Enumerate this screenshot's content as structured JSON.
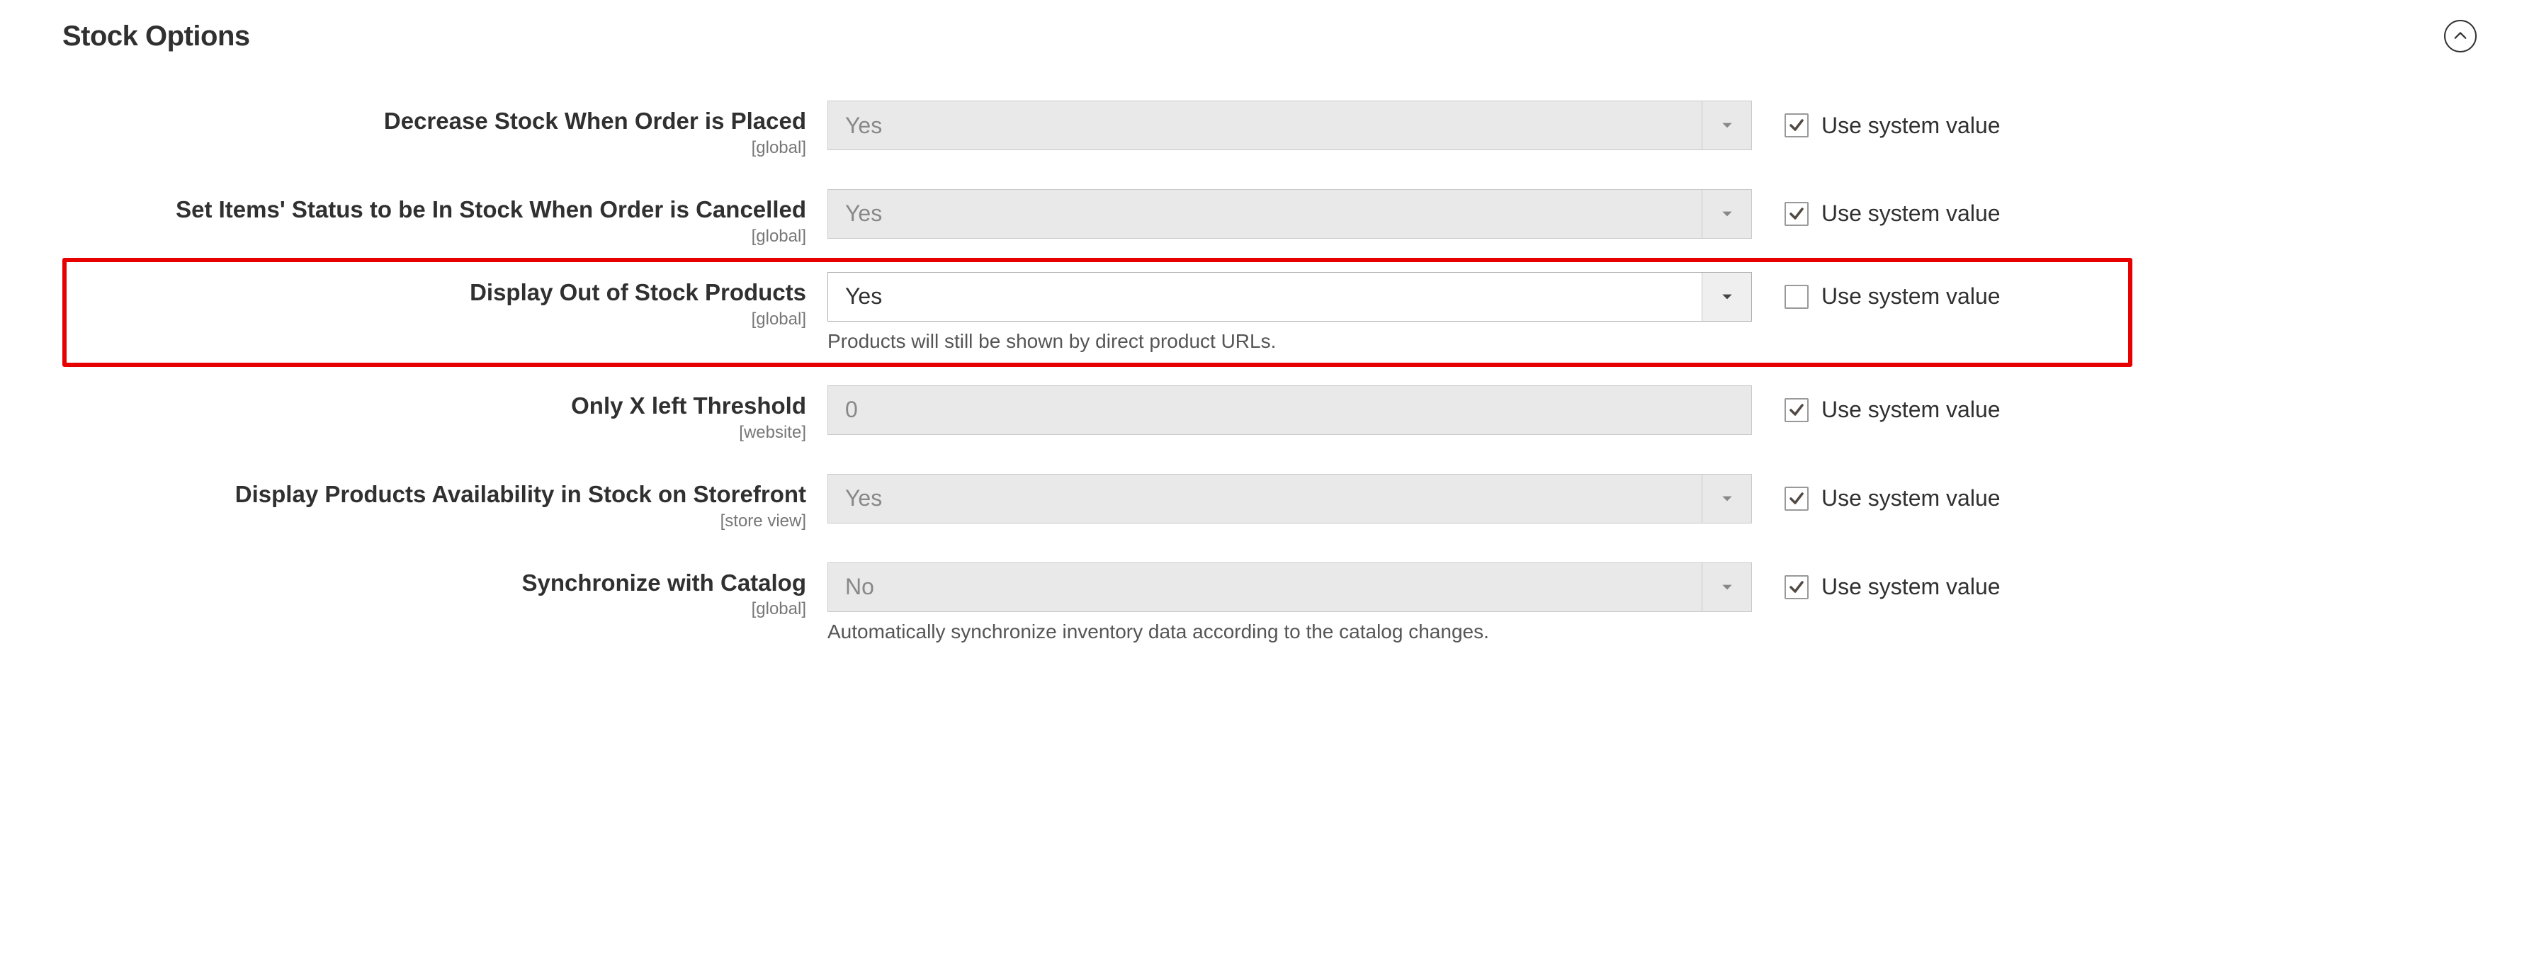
{
  "section": {
    "title": "Stock Options"
  },
  "common": {
    "use_system_value": "Use system value"
  },
  "fields": {
    "decrease_stock": {
      "label": "Decrease Stock When Order is Placed",
      "scope": "[global]",
      "value": "Yes",
      "use_system": true
    },
    "set_in_stock_cancel": {
      "label": "Set Items' Status to be In Stock When Order is Cancelled",
      "scope": "[global]",
      "value": "Yes",
      "use_system": true
    },
    "display_out_of_stock": {
      "label": "Display Out of Stock Products",
      "scope": "[global]",
      "value": "Yes",
      "use_system": false,
      "help": "Products will still be shown by direct product URLs."
    },
    "only_x_left": {
      "label": "Only X left Threshold",
      "scope": "[website]",
      "value": "0",
      "use_system": true
    },
    "display_availability": {
      "label": "Display Products Availability in Stock on Storefront",
      "scope": "[store view]",
      "value": "Yes",
      "use_system": true
    },
    "sync_catalog": {
      "label": "Synchronize with Catalog",
      "scope": "[global]",
      "value": "No",
      "use_system": true,
      "help": "Automatically synchronize inventory data according to the catalog changes."
    }
  }
}
